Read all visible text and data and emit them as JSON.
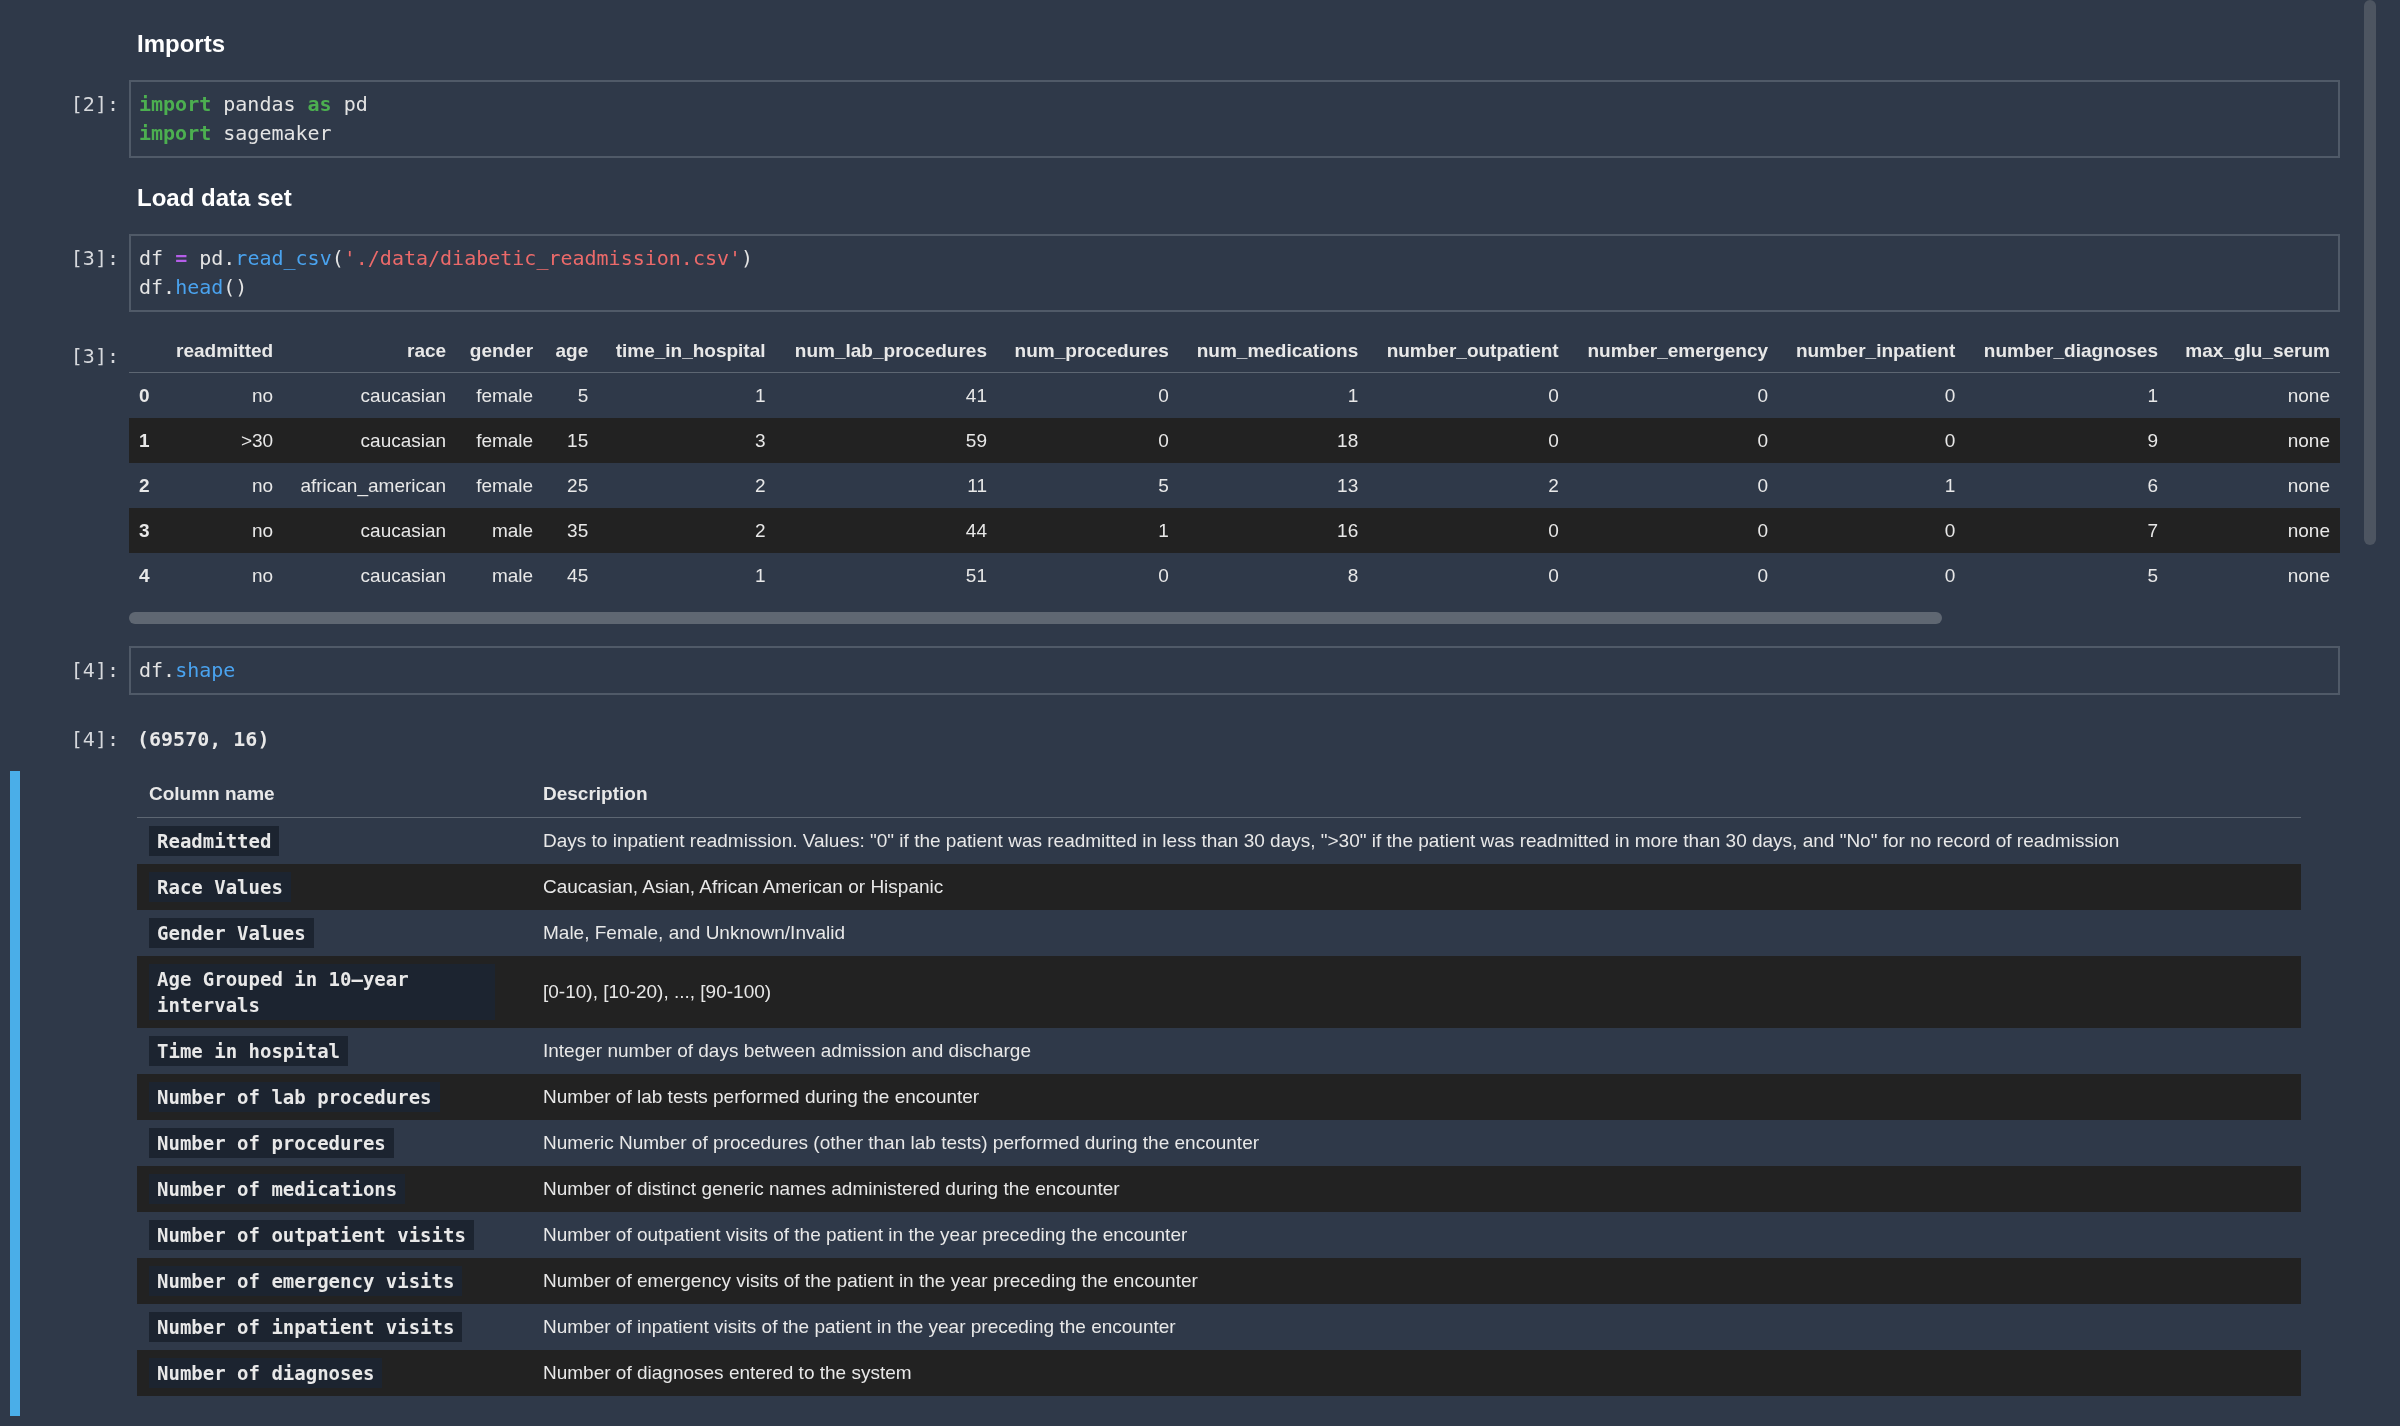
{
  "cells": [
    {
      "kind": "heading",
      "selected": false,
      "text": "Imports"
    },
    {
      "kind": "code",
      "selected": false,
      "prompt": "[2]:",
      "lines": [
        [
          {
            "kind": "keyword",
            "text": "import"
          },
          {
            "kind": "plain",
            "text": " pandas "
          },
          {
            "kind": "keyword",
            "text": "as"
          },
          {
            "kind": "plain",
            "text": " pd"
          }
        ],
        [
          {
            "kind": "keyword",
            "text": "import"
          },
          {
            "kind": "plain",
            "text": " sagemaker"
          }
        ]
      ]
    },
    {
      "kind": "heading",
      "selected": false,
      "text": "Load data set"
    },
    {
      "kind": "code",
      "selected": false,
      "prompt": "[3]:",
      "lines": [
        [
          {
            "kind": "plain",
            "text": "df "
          },
          {
            "kind": "operator",
            "text": "="
          },
          {
            "kind": "plain",
            "text": " pd."
          },
          {
            "kind": "attribute",
            "text": "read_csv"
          },
          {
            "kind": "plain",
            "text": "("
          },
          {
            "kind": "string",
            "text": "'./data/diabetic_readmission.csv'"
          },
          {
            "kind": "plain",
            "text": ")"
          }
        ],
        [
          {
            "kind": "plain",
            "text": "df."
          },
          {
            "kind": "attribute",
            "text": "head"
          },
          {
            "kind": "plain",
            "text": "()"
          }
        ]
      ]
    },
    {
      "kind": "dataframe",
      "selected": false,
      "prompt": "[3]:",
      "columns": [
        "readmitted",
        "race",
        "gender",
        "age",
        "time_in_hospital",
        "num_lab_procedures",
        "num_procedures",
        "num_medications",
        "number_outpatient",
        "number_emergency",
        "number_inpatient",
        "number_diagnoses",
        "max_glu_serum"
      ],
      "rows": [
        {
          "index": "0",
          "cells": [
            "no",
            "caucasian",
            "female",
            "5",
            "1",
            "41",
            "0",
            "1",
            "0",
            "0",
            "0",
            "1",
            "none"
          ]
        },
        {
          "index": "1",
          "cells": [
            ">30",
            "caucasian",
            "female",
            "15",
            "3",
            "59",
            "0",
            "18",
            "0",
            "0",
            "0",
            "9",
            "none"
          ]
        },
        {
          "index": "2",
          "cells": [
            "no",
            "african_american",
            "female",
            "25",
            "2",
            "11",
            "5",
            "13",
            "2",
            "0",
            "1",
            "6",
            "none"
          ]
        },
        {
          "index": "3",
          "cells": [
            "no",
            "caucasian",
            "male",
            "35",
            "2",
            "44",
            "1",
            "16",
            "0",
            "0",
            "0",
            "7",
            "none"
          ]
        },
        {
          "index": "4",
          "cells": [
            "no",
            "caucasian",
            "male",
            "45",
            "1",
            "51",
            "0",
            "8",
            "0",
            "0",
            "0",
            "5",
            "none"
          ]
        }
      ]
    },
    {
      "kind": "code",
      "selected": false,
      "prompt": "[4]:",
      "lines": [
        [
          {
            "kind": "plain",
            "text": "df."
          },
          {
            "kind": "attribute",
            "text": "shape"
          }
        ]
      ]
    },
    {
      "kind": "text-output",
      "selected": false,
      "prompt": "[4]:",
      "text": "(69570, 16)"
    },
    {
      "kind": "markdown-table",
      "selected": true,
      "columns": [
        "Column name",
        "Description"
      ],
      "rows": [
        {
          "name": "Readmitted",
          "description": "Days to inpatient readmission. Values: \"0\" if the patient was readmitted in less than 30 days, \">30\" if the patient was readmitted in more than 30 days, and \"No\" for no record of readmission"
        },
        {
          "name": "Race Values",
          "description": "Caucasian, Asian, African American or Hispanic"
        },
        {
          "name": "Gender Values",
          "description": "Male, Female, and Unknown/Invalid"
        },
        {
          "name": "Age Grouped in 10–year intervals",
          "description": "[0-10), [10-20), ..., [90-100)"
        },
        {
          "name": "Time in hospital",
          "description": "Integer number of days between admission and discharge"
        },
        {
          "name": "Number of lab procedures",
          "description": "Number of lab tests performed during the encounter"
        },
        {
          "name": "Number of procedures",
          "description": "Numeric Number of procedures (other than lab tests) performed during the encounter"
        },
        {
          "name": "Number of medications",
          "description": "Number of distinct generic names administered during the encounter"
        },
        {
          "name": "Number of outpatient visits",
          "description": "Number of outpatient visits of the patient in the year preceding the encounter"
        },
        {
          "name": "Number of emergency visits",
          "description": "Number of emergency visits of the patient in the year preceding the encounter"
        },
        {
          "name": "Number of inpatient visits",
          "description": "Number of inpatient visits of the patient in the year preceding the encounter"
        },
        {
          "name": "Number of diagnoses",
          "description": "Number of diagnoses entered to the system"
        }
      ]
    }
  ]
}
